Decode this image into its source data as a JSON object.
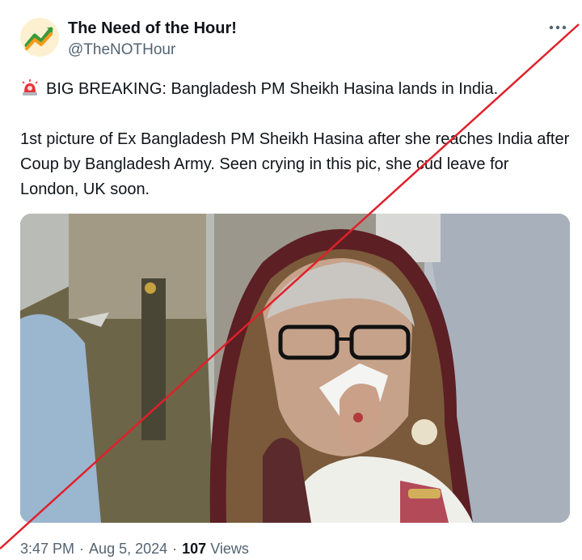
{
  "account": {
    "display_name": "The Need of the Hour!",
    "handle": "@TheNOTHour",
    "avatar_icon": "trend-arrow-logo"
  },
  "tweet": {
    "alert_icon": "police-siren-emoji",
    "line1": "BIG BREAKING: Bangladesh PM Sheikh Hasina lands in India.",
    "line2": "1st picture of Ex Bangladesh PM Sheikh Hasina after she reaches India after Coup by Bangladesh Army. Seen crying in this pic, she cud leave for London, UK soon."
  },
  "photo": {
    "description_icon": "woman-crying-photo"
  },
  "meta": {
    "time": "3:47 PM",
    "separator": "·",
    "date": "Aug 5, 2024",
    "views_count": "107",
    "views_label": "Views"
  },
  "overlay": {
    "cross_line_color": "#e0202a"
  },
  "colors": {
    "text_primary": "#0f1419",
    "text_secondary": "#536471"
  }
}
